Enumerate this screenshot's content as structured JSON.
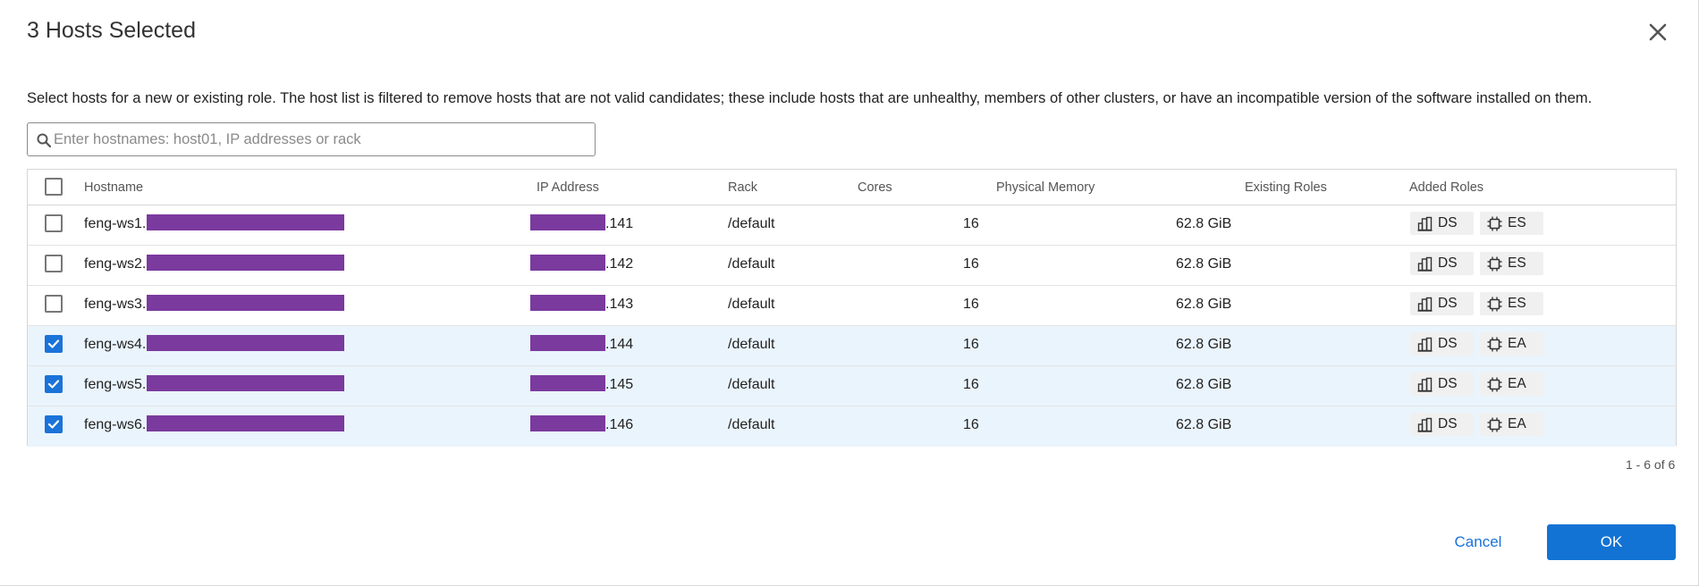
{
  "dialog": {
    "title": "3 Hosts Selected",
    "description": "Select hosts for a new or existing role. The host list is filtered to remove hosts that are not valid candidates; these include hosts that are unhealthy, members of other clusters, or have an incompatible version of the software installed on them.",
    "close_icon": "close-icon"
  },
  "search": {
    "placeholder": "Enter hostnames: host01, IP addresses or rack",
    "value": "",
    "icon": "search-icon"
  },
  "table": {
    "columns": {
      "hostname": "Hostname",
      "ip": "IP Address",
      "rack": "Rack",
      "cores": "Cores",
      "memory": "Physical Memory",
      "existing_roles": "Existing Roles",
      "added_roles": "Added Roles"
    },
    "rows": [
      {
        "hostname": "feng-ws1.",
        "ip": ".141",
        "rack": "/default",
        "cores": "16",
        "memory": "62.8 GiB",
        "existing_roles": "",
        "role1": "DS",
        "role2": "ES",
        "checked": false
      },
      {
        "hostname": "feng-ws2.",
        "ip": ".142",
        "rack": "/default",
        "cores": "16",
        "memory": "62.8 GiB",
        "existing_roles": "",
        "role1": "DS",
        "role2": "ES",
        "checked": false
      },
      {
        "hostname": "feng-ws3.",
        "ip": ".143",
        "rack": "/default",
        "cores": "16",
        "memory": "62.8 GiB",
        "existing_roles": "",
        "role1": "DS",
        "role2": "ES",
        "checked": false
      },
      {
        "hostname": "feng-ws4.",
        "ip": ".144",
        "rack": "/default",
        "cores": "16",
        "memory": "62.8 GiB",
        "existing_roles": "",
        "role1": "DS",
        "role2": "EA",
        "checked": true
      },
      {
        "hostname": "feng-ws5.",
        "ip": ".145",
        "rack": "/default",
        "cores": "16",
        "memory": "62.8 GiB",
        "existing_roles": "",
        "role1": "DS",
        "role2": "EA",
        "checked": true
      },
      {
        "hostname": "feng-ws6.",
        "ip": ".146",
        "rack": "/default",
        "cores": "16",
        "memory": "62.8 GiB",
        "existing_roles": "",
        "role1": "DS",
        "role2": "EA",
        "checked": true
      }
    ],
    "pagination": "1 - 6 of 6"
  },
  "footer": {
    "cancel_label": "Cancel",
    "ok_label": "OK"
  },
  "colors": {
    "accent": "#1273d4",
    "selected_row": "#eaf4fc",
    "redaction": "#7b3a9e"
  }
}
